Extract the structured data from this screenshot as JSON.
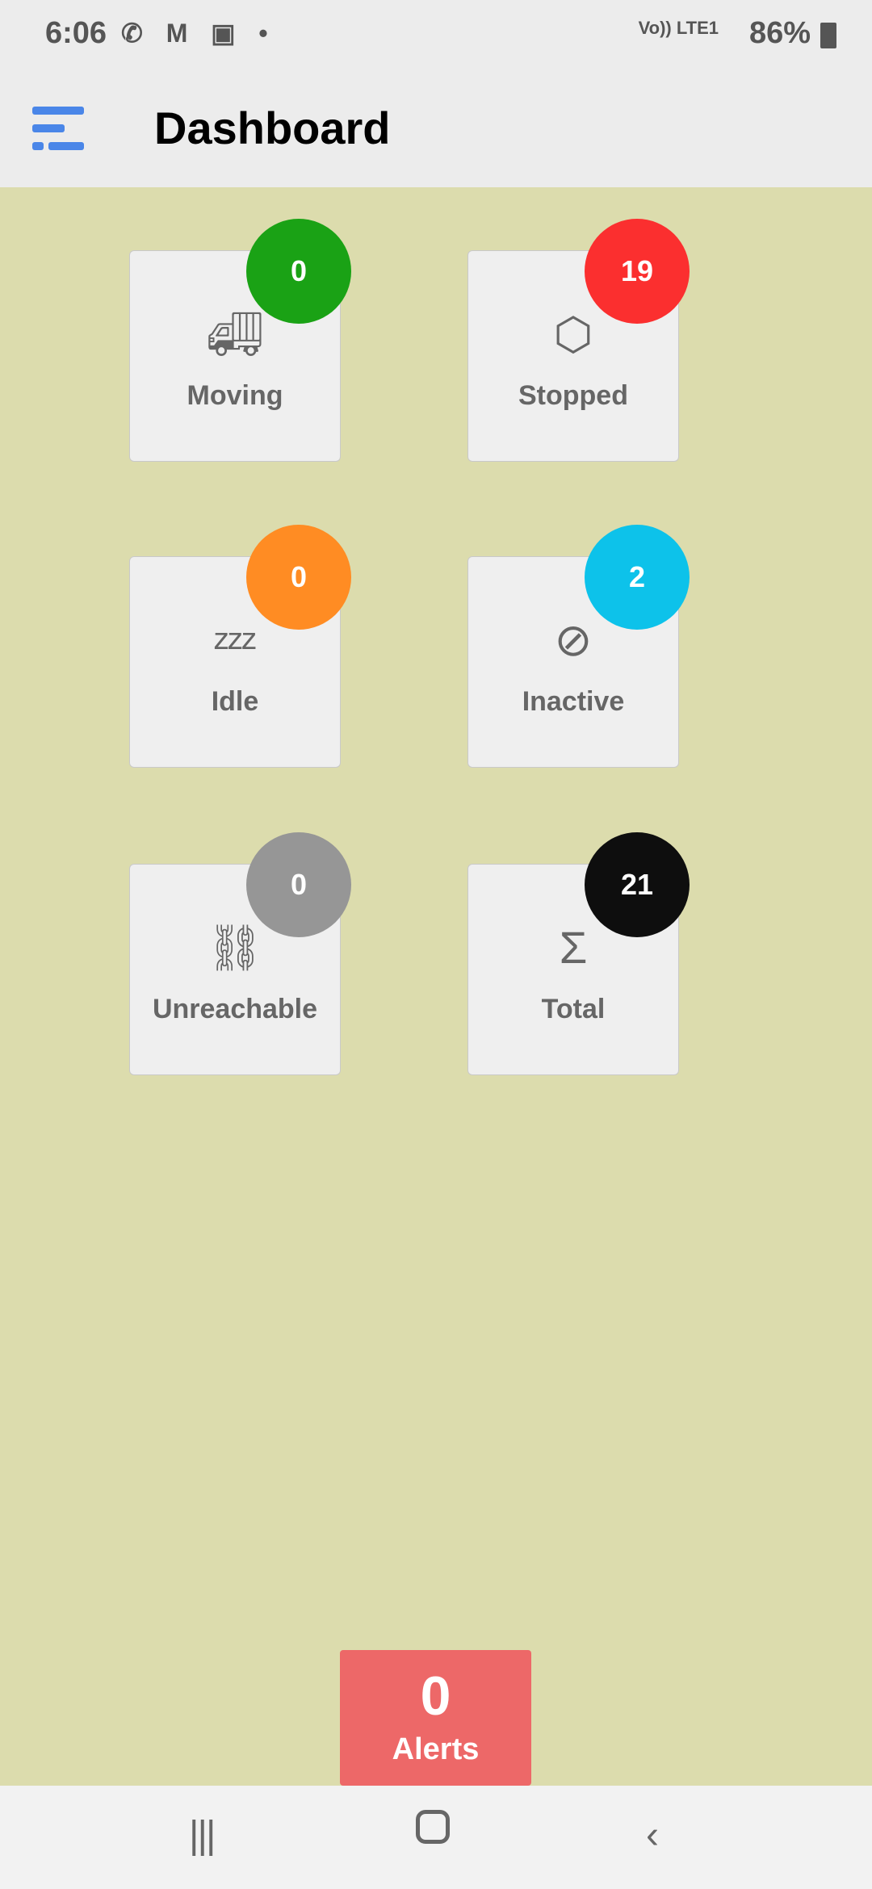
{
  "status_bar": {
    "time": "6:06",
    "notification_icons": [
      "whatsapp-icon",
      "gmail-icon",
      "voicemail-icon",
      "dot-icon"
    ],
    "network": "Vo)) LTE1",
    "battery": "86%"
  },
  "header": {
    "title": "Dashboard",
    "menu_icon": "menu-icon"
  },
  "tiles": [
    {
      "label": "Moving",
      "count": "0",
      "icon": "truck-fast-icon",
      "color": "#1aa215"
    },
    {
      "label": "Stopped",
      "count": "19",
      "icon": "stop-sign-icon",
      "color": "#fb2f2f"
    },
    {
      "label": "Idle",
      "count": "0",
      "icon": "sleep-icon",
      "color": "#ff8c23"
    },
    {
      "label": "Inactive",
      "count": "2",
      "icon": "ban-icon",
      "color": "#0dc2ea"
    },
    {
      "label": "Unreachable",
      "count": "0",
      "icon": "broken-link-icon",
      "color": "#969696"
    },
    {
      "label": "Total",
      "count": "21",
      "icon": "sigma-icon",
      "color": "#0e0e0e"
    }
  ],
  "alerts": {
    "count": "0",
    "label": "Alerts",
    "color": "#ed6868"
  },
  "nav_bar": {
    "recents": "recents-icon",
    "home": "home-icon",
    "back": "back-icon"
  }
}
